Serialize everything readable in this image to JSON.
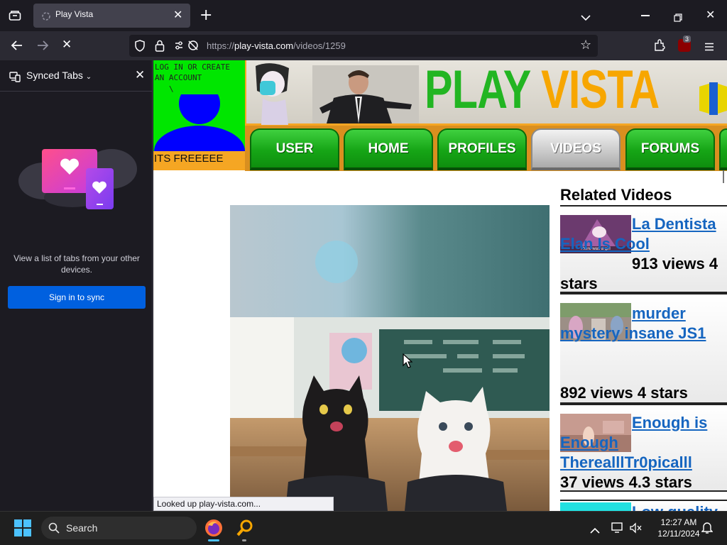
{
  "browser": {
    "tab_title": "Play Vista",
    "url_prefix": "https://",
    "url_host": "play-vista.com",
    "url_path": "/videos/1259",
    "extension_badge": "3",
    "status_text": "Looked up play-vista.com..."
  },
  "sidebar": {
    "title": "Synced Tabs",
    "description": "View a list of tabs from your other devices.",
    "sign_in_label": "Sign in to sync"
  },
  "site": {
    "login_text": "LOG IN OR CREATE AN ACCOUNT",
    "login_arrow": "\\",
    "login_free": "ITS FREEEEE",
    "logo_play": "PLAY",
    "logo_vista": "VISTA",
    "nav": [
      {
        "label": "USER"
      },
      {
        "label": "HOME"
      },
      {
        "label": "PROFILES"
      },
      {
        "label": "VIDEOS",
        "active": true
      },
      {
        "label": "FORUMS"
      }
    ],
    "colors": {
      "green": "#22b522",
      "orange": "#f7a600",
      "link": "#1565c0"
    }
  },
  "related": {
    "title": "Related Videos",
    "items": [
      {
        "title": "La Dentista Elan Is Cool",
        "stats": "913 views 4 stars",
        "thumb_caption": "There was a girl"
      },
      {
        "title": "murder mystery insane JS1",
        "stats": "892 views 4 stars"
      },
      {
        "title": "Enough is Enough TherealllTr0picalll",
        "stats": "37 views 4.3 stars"
      },
      {
        "title": "Low quality"
      }
    ]
  },
  "taskbar": {
    "search_label": "Search",
    "time": "12:27 AM",
    "date": "12/11/2024"
  }
}
